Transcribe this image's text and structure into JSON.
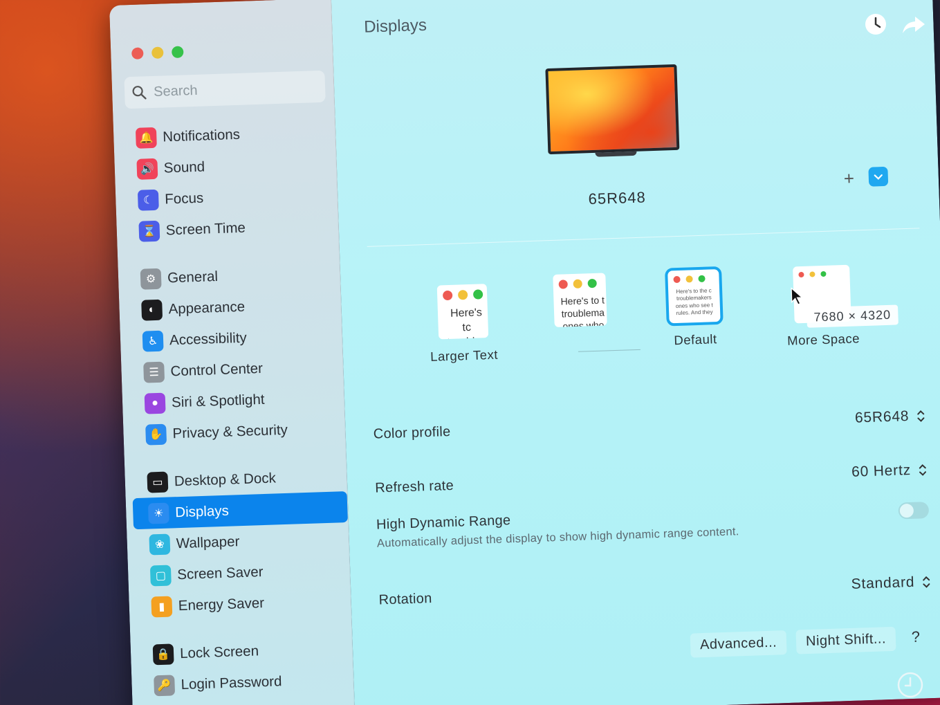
{
  "window_title": "Displays",
  "search": {
    "placeholder": "Search"
  },
  "sidebar": {
    "groups": [
      {
        "items": [
          {
            "label": "Notifications",
            "icon": "bell-icon",
            "color": "#f0435a"
          },
          {
            "label": "Sound",
            "icon": "speaker-icon",
            "color": "#f0435a"
          },
          {
            "label": "Focus",
            "icon": "moon-icon",
            "color": "#4b5ee8"
          },
          {
            "label": "Screen Time",
            "icon": "hourglass-icon",
            "color": "#4b5ee8"
          }
        ]
      },
      {
        "items": [
          {
            "label": "General",
            "icon": "gear-icon",
            "color": "#8e959b"
          },
          {
            "label": "Appearance",
            "icon": "appearance-icon",
            "color": "#1c1c1e"
          },
          {
            "label": "Accessibility",
            "icon": "accessibility-icon",
            "color": "#1f8ef0"
          },
          {
            "label": "Control Center",
            "icon": "control-center-icon",
            "color": "#8e959b"
          },
          {
            "label": "Siri & Spotlight",
            "icon": "siri-icon",
            "color": "#9a46e0"
          },
          {
            "label": "Privacy & Security",
            "icon": "hand-icon",
            "color": "#2b8cf0"
          }
        ]
      },
      {
        "items": [
          {
            "label": "Desktop & Dock",
            "icon": "dock-icon",
            "color": "#1c1c1e"
          },
          {
            "label": "Displays",
            "icon": "sun-icon",
            "color": "#2b8cf0",
            "active": true
          },
          {
            "label": "Wallpaper",
            "icon": "wallpaper-icon",
            "color": "#2fb7e0"
          },
          {
            "label": "Screen Saver",
            "icon": "screen-saver-icon",
            "color": "#30c0d8"
          },
          {
            "label": "Energy Saver",
            "icon": "battery-icon",
            "color": "#f4a020"
          }
        ]
      },
      {
        "items": [
          {
            "label": "Lock Screen",
            "icon": "lock-icon",
            "color": "#1c1c1e"
          },
          {
            "label": "Login Password",
            "icon": "key-icon",
            "color": "#8e959b"
          }
        ]
      }
    ]
  },
  "display": {
    "name": "65R648",
    "add_label": "+"
  },
  "resolutions": {
    "larger_text": {
      "label": "Larger Text",
      "preview": [
        "Here's tc",
        "troublen"
      ]
    },
    "middle": {
      "label": "",
      "preview": [
        "Here's to t",
        "troublema",
        "ones who"
      ]
    },
    "default": {
      "label": "Default",
      "preview": [
        "Here's to the c",
        "troublemakers",
        "ones who see t",
        "rules. And they"
      ]
    },
    "more_space": {
      "label": "More Space",
      "tooltip": "7680 × 4320"
    }
  },
  "settings": {
    "color_profile": {
      "label": "Color profile",
      "value": "65R648"
    },
    "refresh_rate": {
      "label": "Refresh rate",
      "value": "60 Hertz"
    },
    "hdr": {
      "label": "High Dynamic Range",
      "description": "Automatically adjust the display to show high dynamic range content.",
      "enabled": false
    },
    "rotation": {
      "label": "Rotation",
      "value": "Standard"
    }
  },
  "buttons": {
    "advanced": "Advanced...",
    "night_shift": "Night Shift...",
    "help": "?"
  }
}
